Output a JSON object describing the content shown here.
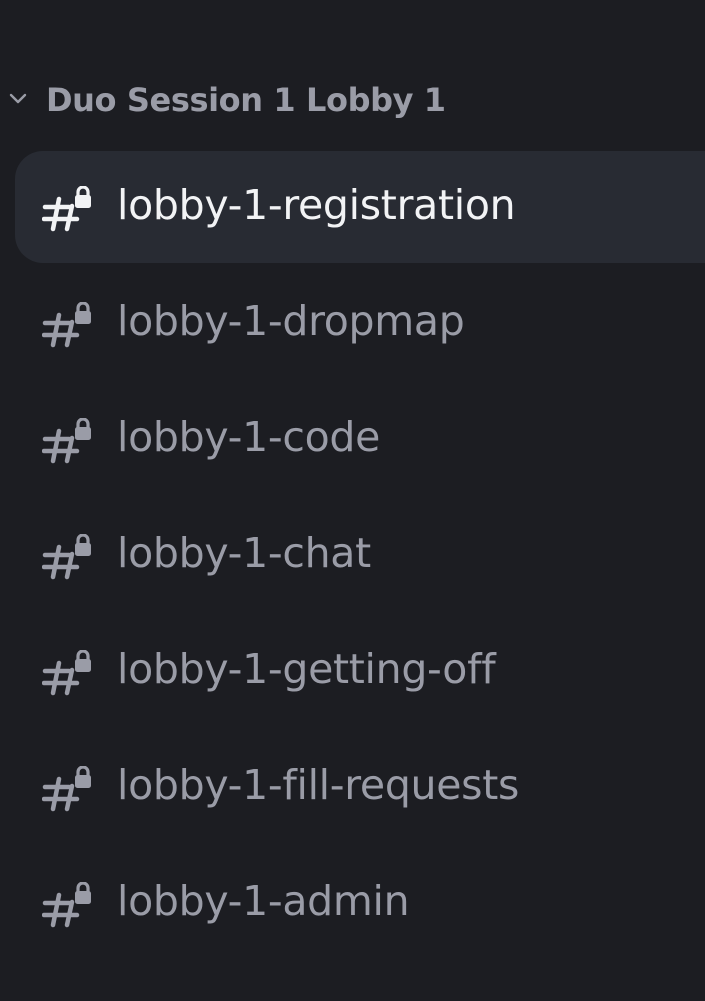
{
  "category": {
    "label": "Duo Session 1 Lobby 1",
    "expanded": true,
    "chevron_icon": "chevron-down-icon"
  },
  "channels": [
    {
      "name": "lobby-1-registration",
      "icon": "locked-text-channel-icon",
      "selected": true
    },
    {
      "name": "lobby-1-dropmap",
      "icon": "locked-text-channel-icon",
      "selected": false
    },
    {
      "name": "lobby-1-code",
      "icon": "locked-text-channel-icon",
      "selected": false
    },
    {
      "name": "lobby-1-chat",
      "icon": "locked-text-channel-icon",
      "selected": false
    },
    {
      "name": "lobby-1-getting-off",
      "icon": "locked-text-channel-icon",
      "selected": false
    },
    {
      "name": "lobby-1-fill-requests",
      "icon": "locked-text-channel-icon",
      "selected": false
    },
    {
      "name": "lobby-1-admin",
      "icon": "locked-text-channel-icon",
      "selected": false
    }
  ],
  "colors": {
    "background": "#1c1d22",
    "selected_row": "#282b33",
    "text_muted": "#9a9ca7",
    "text_active": "#f2f3f5"
  }
}
